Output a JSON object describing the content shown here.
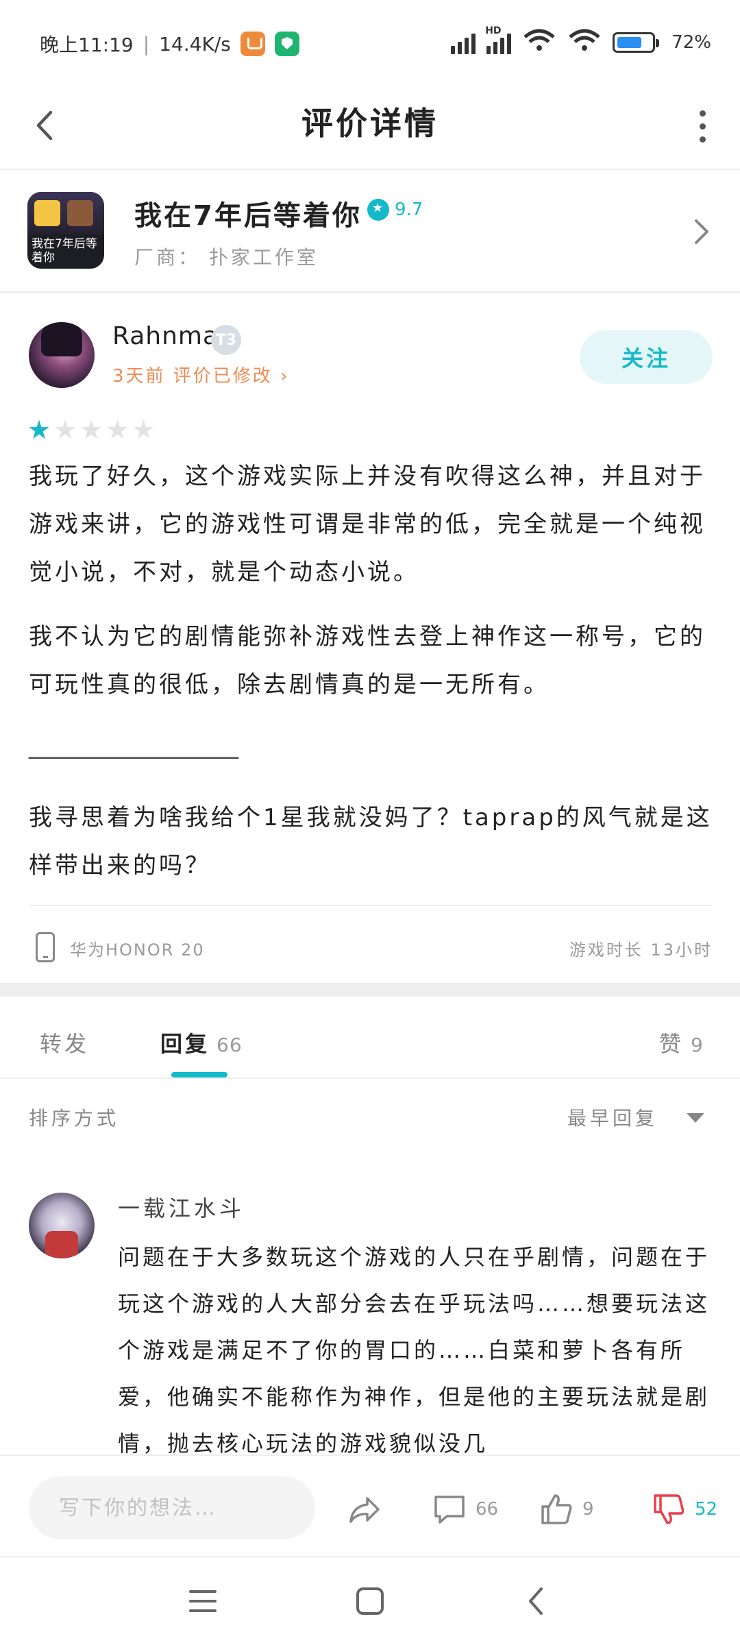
{
  "status_bar": {
    "time": "晚上11:19",
    "network_speed": "14.4K/s",
    "battery_percent": "72%",
    "battery_level": 0.72,
    "signal_label": "HD"
  },
  "header": {
    "title": "评价详情"
  },
  "game": {
    "name": "我在7年后等着你",
    "rating": "9.7",
    "vendor": "厂商：  扑家工作室",
    "cover_text": "我在7年后等着你"
  },
  "review": {
    "author": "Rahnmax",
    "level": "T3",
    "meta": "3天前 评价已修改 ›",
    "follow_label": "关注",
    "star_rating": 1,
    "star_max": 5,
    "paragraphs": [
      "我玩了好久，这个游戏实际上并没有吹得这么神，并且对于游戏来讲，它的游戏性可谓是非常的低，完全就是一个纯视觉小说，不对，就是个动态小说。",
      "我不认为它的剧情能弥补游戏性去登上神作这一称号，它的可玩性真的很低，除去剧情真的是一无所有。",
      "__________________",
      "我寻思着为啥我给个1星我就没妈了？taprap的风气就是这样带出来的吗？"
    ],
    "device": "华为HONOR 20",
    "play_time": "游戏时长  13小时"
  },
  "tabs": {
    "repost": "转发",
    "reply": "回复",
    "reply_count": "66",
    "like": "赞",
    "like_count": "9"
  },
  "sort": {
    "label": "排序方式",
    "value": "最早回复"
  },
  "first_reply": {
    "author": "一载江水斗",
    "text": "问题在于大多数玩这个游戏的人只在乎剧情，问题在于玩这个游戏的人大部分会去在乎玩法吗……想要玩法这个游戏是满足不了你的胃口的……白菜和萝卜各有所爱，他确实不能称作为神作，但是他的主要玩法就是剧情，抛去核心玩法的游戏貌似没几"
  },
  "action_bar": {
    "input_placeholder": "写下你的想法…",
    "comment_count": "66",
    "like_count": "9",
    "dislike_count": "52",
    "accent_color": "#14b9c8",
    "dislike_color": "#e8404a"
  }
}
